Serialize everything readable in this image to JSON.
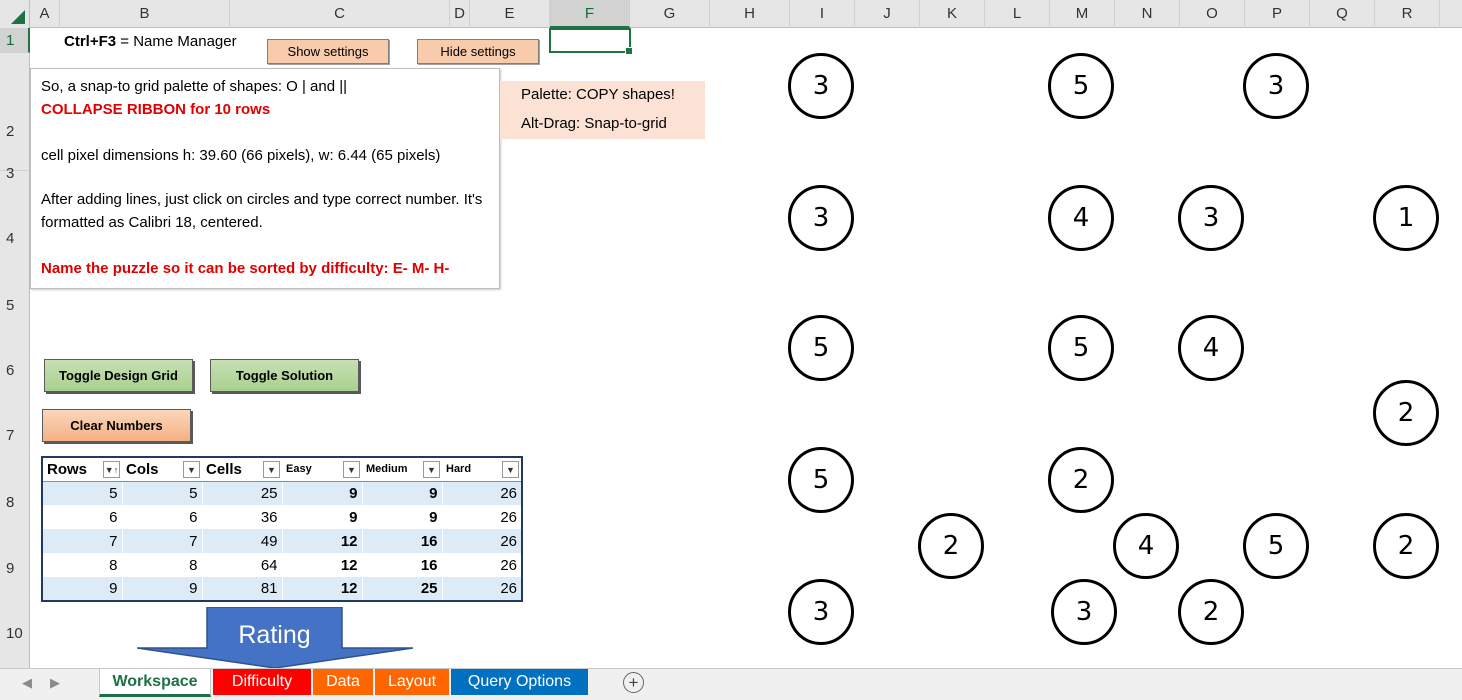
{
  "columns": [
    "A",
    "B",
    "C",
    "D",
    "E",
    "F",
    "G",
    "H",
    "I",
    "J",
    "K",
    "L",
    "M",
    "N",
    "O",
    "P",
    "Q",
    "R"
  ],
  "rows": [
    "1",
    "2",
    "3",
    "4",
    "5",
    "6",
    "7",
    "8",
    "9",
    "10"
  ],
  "selected_cell": {
    "column": "F",
    "row": "1"
  },
  "cell_b1": {
    "shortcut": "Ctrl+F3",
    "rest": " = Name Manager"
  },
  "buttons": {
    "show_settings": "Show settings",
    "hide_settings": "Hide settings",
    "toggle_design_grid": "Toggle Design Grid",
    "toggle_solution": "Toggle Solution",
    "clear_numbers": "Clear Numbers"
  },
  "note": {
    "line1": "So, a snap-to grid palette of shapes: O | and ||",
    "line2": "COLLAPSE RIBBON for 10 rows",
    "line3": "cell pixel dimensions h: 39.60 (66 pixels), w: 6.44 (65 pixels)",
    "line4": "After adding lines, just click on circles and type correct number. It's formatted as Calibri 18, centered.",
    "line5": "Name the puzzle so it can be sorted by difficulty: E- M- H-"
  },
  "palette": {
    "line1": "Palette: COPY shapes!",
    "line2": "Alt-Drag: Snap-to-grid"
  },
  "table": {
    "headers": [
      "Rows",
      "Cols",
      "Cells",
      "Easy",
      "Medium",
      "Hard"
    ],
    "rows": [
      [
        "5",
        "5",
        "25",
        "9",
        "9",
        "26"
      ],
      [
        "6",
        "6",
        "36",
        "9",
        "9",
        "26"
      ],
      [
        "7",
        "7",
        "49",
        "12",
        "16",
        "26"
      ],
      [
        "8",
        "8",
        "64",
        "12",
        "16",
        "26"
      ],
      [
        "9",
        "9",
        "81",
        "12",
        "25",
        "26"
      ]
    ]
  },
  "puzzle_circles": [
    {
      "row": 2,
      "col": "I",
      "value": "3"
    },
    {
      "row": 2,
      "col": "M",
      "value": "5"
    },
    {
      "row": 2,
      "col": "P",
      "value": "3"
    },
    {
      "row": 4,
      "col": "I",
      "value": "3"
    },
    {
      "row": 4,
      "col": "M",
      "value": "4"
    },
    {
      "row": 4,
      "col": "O",
      "value": "3"
    },
    {
      "row": 4,
      "col": "R",
      "value": "1"
    },
    {
      "row": 6,
      "col": "I",
      "value": "5"
    },
    {
      "row": 6,
      "col": "M",
      "value": "5"
    },
    {
      "row": 6,
      "col": "O",
      "value": "4"
    },
    {
      "row": 7,
      "col": "R",
      "value": "2"
    },
    {
      "row": 8,
      "col": "I",
      "value": "5"
    },
    {
      "row": 8,
      "col": "M",
      "value": "2"
    },
    {
      "row": 9,
      "col": "K",
      "value": "2"
    },
    {
      "row": 9,
      "col": "N",
      "value": "4"
    },
    {
      "row": 9,
      "col": "P",
      "value": "5"
    },
    {
      "row": 9,
      "col": "R",
      "value": "2"
    },
    {
      "row": 10,
      "col": "I",
      "value": "3"
    },
    {
      "row": 10,
      "col": "M",
      "value": "3"
    },
    {
      "row": 10,
      "col": "O",
      "value": "2"
    }
  ],
  "arrow_label": "Rating",
  "sheet_tabs": [
    {
      "label": "Workspace",
      "color": "#ffffff",
      "active": true
    },
    {
      "label": "Difficulty",
      "color": "#ff0000",
      "active": false
    },
    {
      "label": "Data",
      "color": "#ff6600",
      "active": false
    },
    {
      "label": "Layout",
      "color": "#ff6600",
      "active": false
    },
    {
      "label": "Query Options",
      "color": "#0070c0",
      "active": false
    }
  ],
  "icons": {
    "nav_prev": "triangle-left-icon",
    "nav_next": "triangle-right-icon",
    "add_sheet": "plus-circle-icon",
    "filter": "dropdown-arrow-icon"
  },
  "colors": {
    "accent": "#217346",
    "table_band": "#ddebf7",
    "note_red": "#e00000",
    "arrow_fill": "#4472c4"
  }
}
